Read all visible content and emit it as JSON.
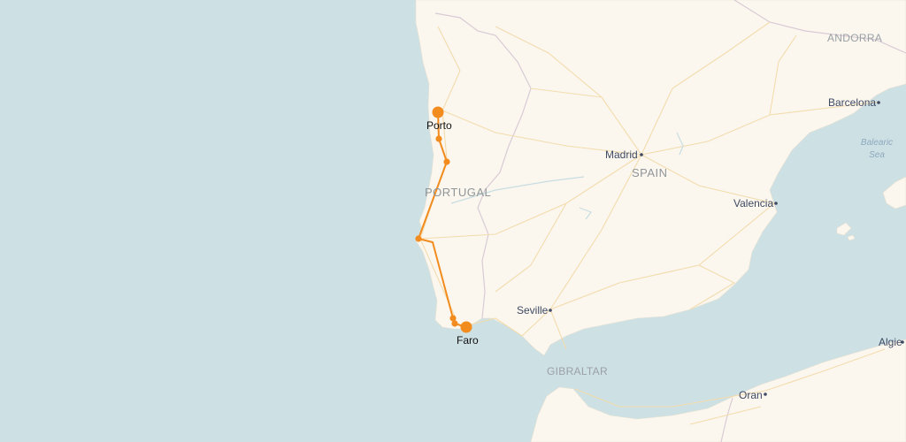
{
  "colors": {
    "water": "#cde0e4",
    "land": "#fbf7ee",
    "road": "#f3dcae",
    "border": "#d9cbd6",
    "route": "#f28c1e"
  },
  "places": {
    "andorra": "ANDORRA",
    "barcelona": "Barcelona",
    "balearic_line1": "Balearic",
    "balearic_line2": "Sea",
    "madrid": "Madrid",
    "spain": "SPAIN",
    "portugal": "PORTUGAL",
    "valencia": "Valencia",
    "seville": "Seville",
    "gibraltar": "GIBRALTAR",
    "oran": "Oran",
    "algiers_partial": "Algie"
  },
  "route": {
    "origin": "Porto",
    "destination": "Faro"
  }
}
